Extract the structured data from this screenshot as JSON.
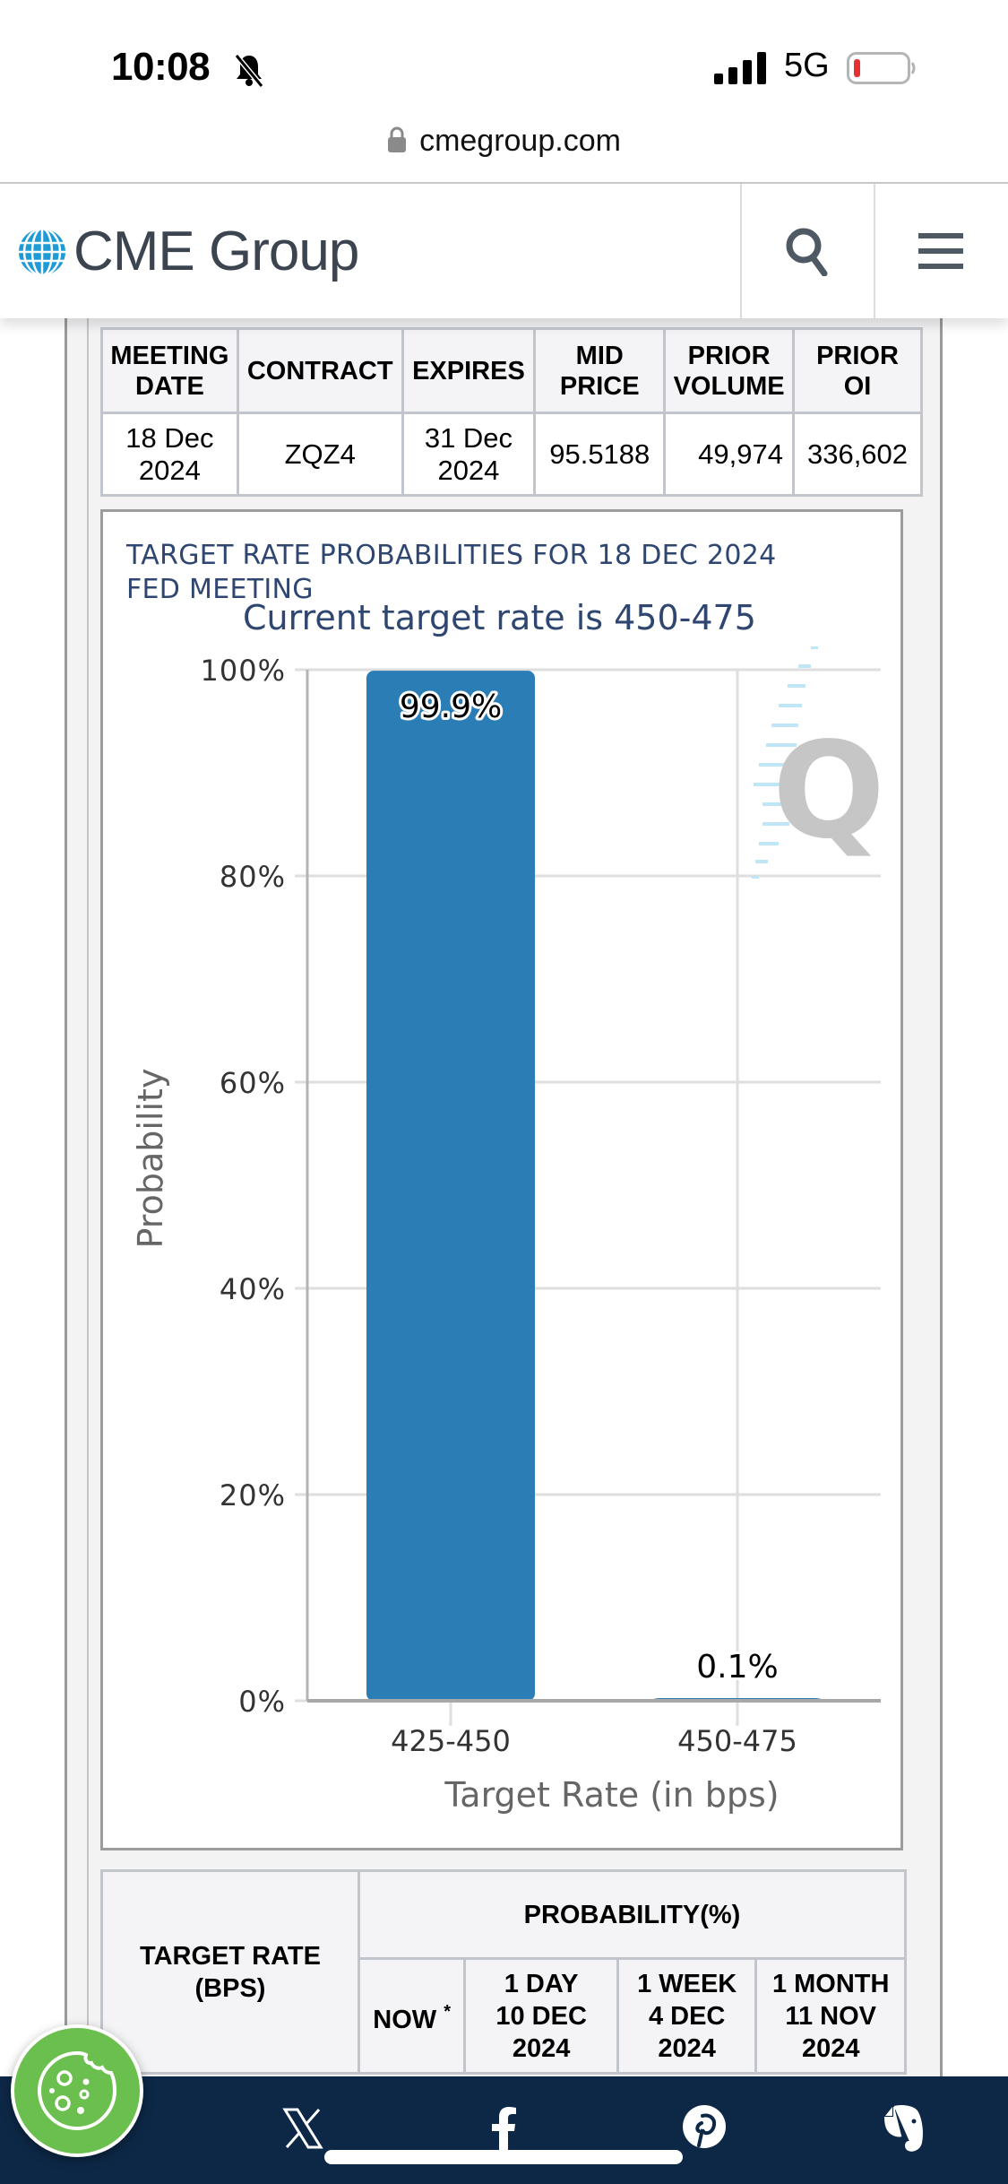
{
  "status_bar": {
    "time": "10:08",
    "network": "5G",
    "silent_icon": "bell-slash-icon",
    "signal_icon": "cellular-signal-icon",
    "battery_icon": "battery-low-icon",
    "battery_color": "#e5312f"
  },
  "browser": {
    "url": "cmegroup.com",
    "lock_icon": "lock-icon"
  },
  "header": {
    "logo_text": "CME Group",
    "logo_icon": "globe-icon",
    "brand_color": "#1e9ad6",
    "search_icon": "search-icon",
    "menu_icon": "hamburger-menu-icon"
  },
  "contract_table": {
    "columns": [
      "MEETING DATE",
      "CONTRACT",
      "EXPIRES",
      "MID PRICE",
      "PRIOR VOLUME",
      "PRIOR OI"
    ],
    "column_lines": [
      [
        "MEETING",
        "DATE"
      ],
      [
        "CONTRACT"
      ],
      [
        "EXPIRES"
      ],
      [
        "MID",
        "PRICE"
      ],
      [
        "PRIOR",
        "VOLUME"
      ],
      [
        "PRIOR",
        "OI"
      ]
    ],
    "rows": [
      {
        "meeting_date": [
          "18 Dec",
          "2024"
        ],
        "contract": "ZQZ4",
        "expires": [
          "31 Dec",
          "2024"
        ],
        "mid_price": "95.5188",
        "prior_volume": "49,974",
        "prior_oi": "336,602"
      }
    ]
  },
  "chart_data": {
    "type": "bar",
    "title": "TARGET RATE PROBABILITIES FOR 18 DEC 2024 FED MEETING",
    "title_lines": [
      "TARGET RATE PROBABILITIES FOR 18 DEC 2024",
      "FED MEETING"
    ],
    "subtitle": "Current target rate is 450-475",
    "xlabel": "Target Rate (in bps)",
    "ylabel": "Probability",
    "categories": [
      "425-450",
      "450-475"
    ],
    "values": [
      99.9,
      0.1
    ],
    "data_labels": [
      "99.9%",
      "0.1%"
    ],
    "ylim": [
      0,
      100
    ],
    "yticks": [
      0,
      20,
      40,
      60,
      80,
      100
    ],
    "ytick_labels": [
      "0%",
      "20%",
      "40%",
      "60%",
      "80%",
      "100%"
    ],
    "grid": true,
    "bar_color": "#2a7db5",
    "watermark": "Q",
    "legend": "none"
  },
  "probability_table": {
    "header_left": [
      "TARGET RATE",
      "(BPS)"
    ],
    "header_group": "PROBABILITY(%)",
    "columns": [
      {
        "lines": [
          "NOW"
        ],
        "note": "*"
      },
      {
        "lines": [
          "1 DAY",
          "10 DEC",
          "2024"
        ]
      },
      {
        "lines": [
          "1 WEEK",
          "4 DEC",
          "2024"
        ]
      },
      {
        "lines": [
          "1 MONTH",
          "11 NOV",
          "2024"
        ]
      }
    ]
  },
  "footer": {
    "share_icons": [
      "x-twitter-icon",
      "facebook-icon",
      "pinterest-icon",
      "evernote-icon"
    ],
    "background": "#0d2847"
  },
  "cookie_button": {
    "icon": "cookie-icon",
    "color": "#6bbf4e"
  }
}
